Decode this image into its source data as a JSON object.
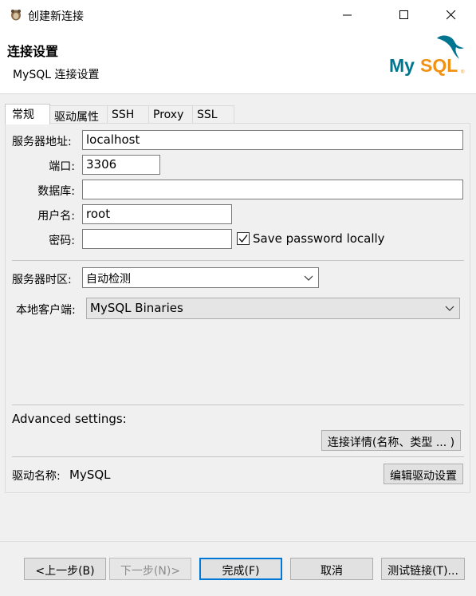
{
  "window": {
    "title": "创建新连接",
    "minimize_icon": "minimize-icon",
    "maximize_icon": "maximize-icon",
    "close_icon": "close-icon"
  },
  "header": {
    "title": "连接设置",
    "subtitle": "MySQL 连接设置",
    "logo_text": "MySQL"
  },
  "tabs": [
    {
      "label": "常规",
      "active": true
    },
    {
      "label": "驱动属性"
    },
    {
      "label": "SSH"
    },
    {
      "label": "Proxy"
    },
    {
      "label": "SSL"
    }
  ],
  "form": {
    "host_label": "服务器地址:",
    "host_value": "localhost",
    "port_label": "端口:",
    "port_value": "3306",
    "database_label": "数据库:",
    "database_value": "",
    "user_label": "用户名:",
    "user_value": "root",
    "password_label": "密码:",
    "password_value": "",
    "save_password_label": "Save password locally",
    "save_password_checked": true,
    "timezone_label": "服务器时区:",
    "timezone_value": "自动检测",
    "client_label": "本地客户端:",
    "client_value": "MySQL Binaries",
    "advanced_label": "Advanced settings:",
    "conn_details_button": "连接详情(名称、类型 ... )",
    "driver_label": "驱动名称:",
    "driver_value": "MySQL",
    "edit_driver_button": "编辑驱动设置"
  },
  "footer": {
    "back_button": "<上一步(B)",
    "next_button": "下一步(N)>",
    "finish_button": "完成(F)",
    "cancel_button": "取消",
    "test_button": "测试链接(T)..."
  },
  "colors": {
    "mysql_blue": "#00758f",
    "mysql_orange": "#f29111",
    "focus_blue": "#0078d7"
  }
}
